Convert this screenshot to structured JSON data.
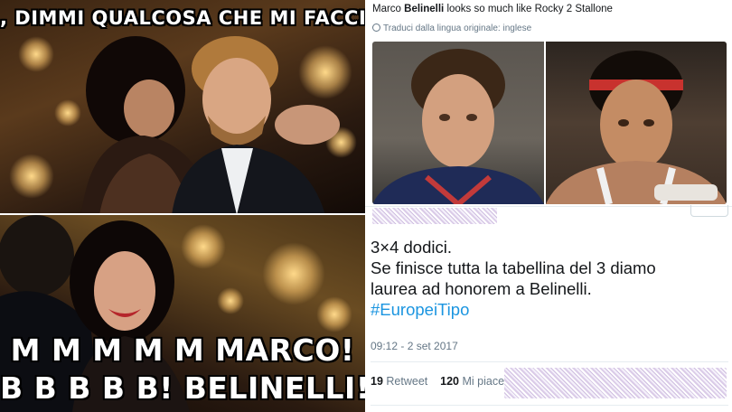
{
  "meme": {
    "top_caption": ", DIMMI QUALCOSA CHE MI FACCIA ECCITARE",
    "bottom_line1": "M M M M M MARCO!",
    "bottom_line2": "B B B B B! BELINELLI!"
  },
  "tweet": {
    "title_name": "Marco",
    "title_bold": "Belinelli",
    "title_rest": " looks so much like Rocky 2 Stallone",
    "translate_note": "Traduci dalla lingua originale: inglese",
    "body_line1": "3×4 dodici.",
    "body_line2": "Se finisce tutta la tabellina del 3 diamo",
    "body_line3": "laurea ad honorem a Belinelli.",
    "hashtag": "#EuropeiTipo",
    "timestamp": "09:12 - 2 set 2017",
    "retweet_count": "19",
    "retweet_label": "Retweet",
    "like_count": "120",
    "like_label": "Mi piace"
  },
  "colors": {
    "hashtag": "#1b95e0",
    "meta_text": "#657786",
    "body_text": "#14171a"
  }
}
